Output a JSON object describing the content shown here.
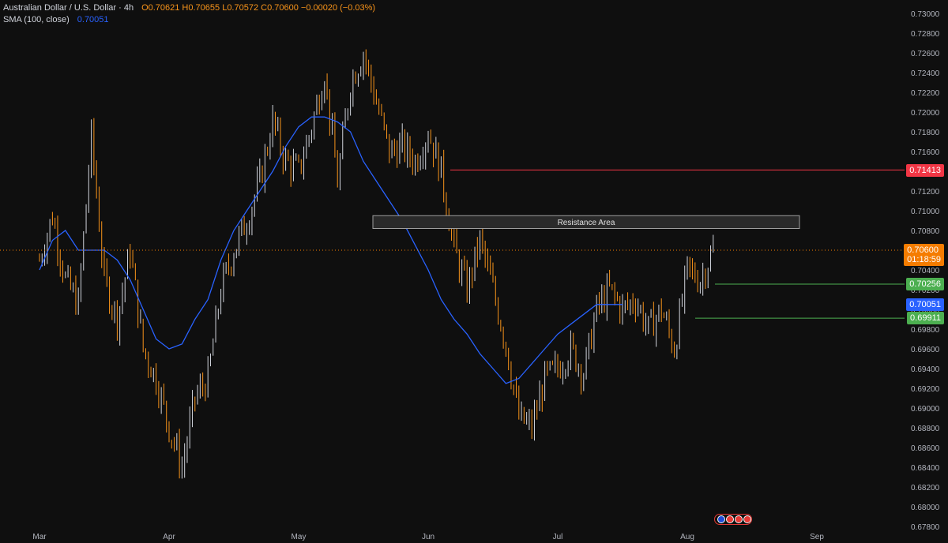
{
  "header": {
    "symbol": "Australian Dollar / U.S. Dollar · 4h",
    "ohlc": "O0.70621 H0.70655 L0.70572 C0.70600 −0.00020 (−0.03%)",
    "sma_label": "SMA (100, close)",
    "sma_value": "0.70051"
  },
  "annotations": {
    "resistance_label": "Resistance Area",
    "resistance_range": [
      0.7082,
      0.7095
    ],
    "red_line_level": 0.71413,
    "green_line_1_level": 0.70256,
    "green_line_2_level": 0.69911
  },
  "price_tags": {
    "red": "0.71413",
    "current": "0.70600",
    "countdown": "01:18:59",
    "green_1": "0.70256",
    "sma": "0.70051",
    "green_2": "0.69911"
  },
  "colors": {
    "background": "#0f0f0f",
    "candle": "#f7931a",
    "sma": "#2962ff",
    "red": "#f23645",
    "green": "#4caf50",
    "current": "#f57c00"
  },
  "chart_data": {
    "type": "line",
    "title": "Australian Dollar / U.S. Dollar · 4h",
    "xlabel": "",
    "ylabel": "",
    "x_ticks": [
      "Mar",
      "Apr",
      "May",
      "Jun",
      "Jul",
      "Aug",
      "Sep"
    ],
    "y_ticks": [
      "0.73000",
      "0.72800",
      "0.72600",
      "0.72400",
      "0.72200",
      "0.72000",
      "0.71800",
      "0.71600",
      "0.71400",
      "0.71200",
      "0.71000",
      "0.70800",
      "0.70600",
      "0.70400",
      "0.70200",
      "0.70000",
      "0.69800",
      "0.69600",
      "0.69400",
      "0.69200",
      "0.69000",
      "0.68800",
      "0.68600",
      "0.68400",
      "0.68200",
      "0.68000",
      "0.67800"
    ],
    "ylim": [
      0.678,
      0.73
    ],
    "grid": false,
    "series": [
      {
        "name": "Australian Dollar / U.S. Dollar",
        "style": "candles",
        "x_months": [
          0.0,
          0.1,
          0.2,
          0.3,
          0.4,
          0.5,
          0.6,
          0.7,
          0.8,
          0.9,
          1.0,
          1.1,
          1.2,
          1.3,
          1.4,
          1.5,
          1.6,
          1.7,
          1.8,
          1.9,
          2.0,
          2.1,
          2.2,
          2.3,
          2.4,
          2.5,
          2.6,
          2.7,
          2.8,
          2.9,
          3.0,
          3.1,
          3.2,
          3.3,
          3.4,
          3.5,
          3.6,
          3.7,
          3.8,
          3.9,
          4.0,
          4.1,
          4.2,
          4.3,
          4.4,
          4.5,
          4.6,
          4.7,
          4.8,
          4.9,
          5.0,
          5.1,
          5.2
        ],
        "values": [
          0.705,
          0.7095,
          0.703,
          0.7005,
          0.7175,
          0.703,
          0.699,
          0.706,
          0.696,
          0.693,
          0.688,
          0.684,
          0.691,
          0.693,
          0.702,
          0.706,
          0.709,
          0.713,
          0.719,
          0.715,
          0.714,
          0.7185,
          0.724,
          0.713,
          0.723,
          0.726,
          0.721,
          0.716,
          0.7165,
          0.715,
          0.718,
          0.714,
          0.706,
          0.702,
          0.707,
          0.702,
          0.6965,
          0.689,
          0.688,
          0.693,
          0.694,
          0.696,
          0.6935,
          0.7,
          0.702,
          0.7,
          0.701,
          0.698,
          0.7,
          0.696,
          0.704,
          0.703,
          0.706
        ]
      },
      {
        "name": "SMA (100, close)",
        "style": "line",
        "x_months": [
          0.0,
          0.1,
          0.2,
          0.3,
          0.4,
          0.5,
          0.6,
          0.7,
          0.8,
          0.9,
          1.0,
          1.1,
          1.2,
          1.3,
          1.4,
          1.5,
          1.6,
          1.7,
          1.8,
          1.9,
          2.0,
          2.1,
          2.2,
          2.3,
          2.4,
          2.5,
          2.6,
          2.7,
          2.8,
          2.9,
          3.0,
          3.1,
          3.2,
          3.3,
          3.4,
          3.5,
          3.6,
          3.7,
          3.8,
          3.9,
          4.0,
          4.1,
          4.2,
          4.3,
          4.4,
          4.5,
          4.6,
          4.7,
          4.8,
          4.9,
          5.0,
          5.1,
          5.2
        ],
        "values": [
          0.704,
          0.707,
          0.708,
          0.706,
          0.706,
          0.706,
          0.705,
          0.703,
          0.7,
          0.697,
          0.696,
          0.6965,
          0.699,
          0.701,
          0.705,
          0.708,
          0.71,
          0.712,
          0.714,
          0.7165,
          0.7185,
          0.7195,
          0.7195,
          0.719,
          0.718,
          0.715,
          0.713,
          0.711,
          0.709,
          0.7065,
          0.704,
          0.701,
          0.699,
          0.6975,
          0.6955,
          0.694,
          0.6925,
          0.693,
          0.6945,
          0.696,
          0.6975,
          0.6985,
          0.6995,
          0.7005,
          0.7005,
          0.7005
        ]
      }
    ]
  }
}
